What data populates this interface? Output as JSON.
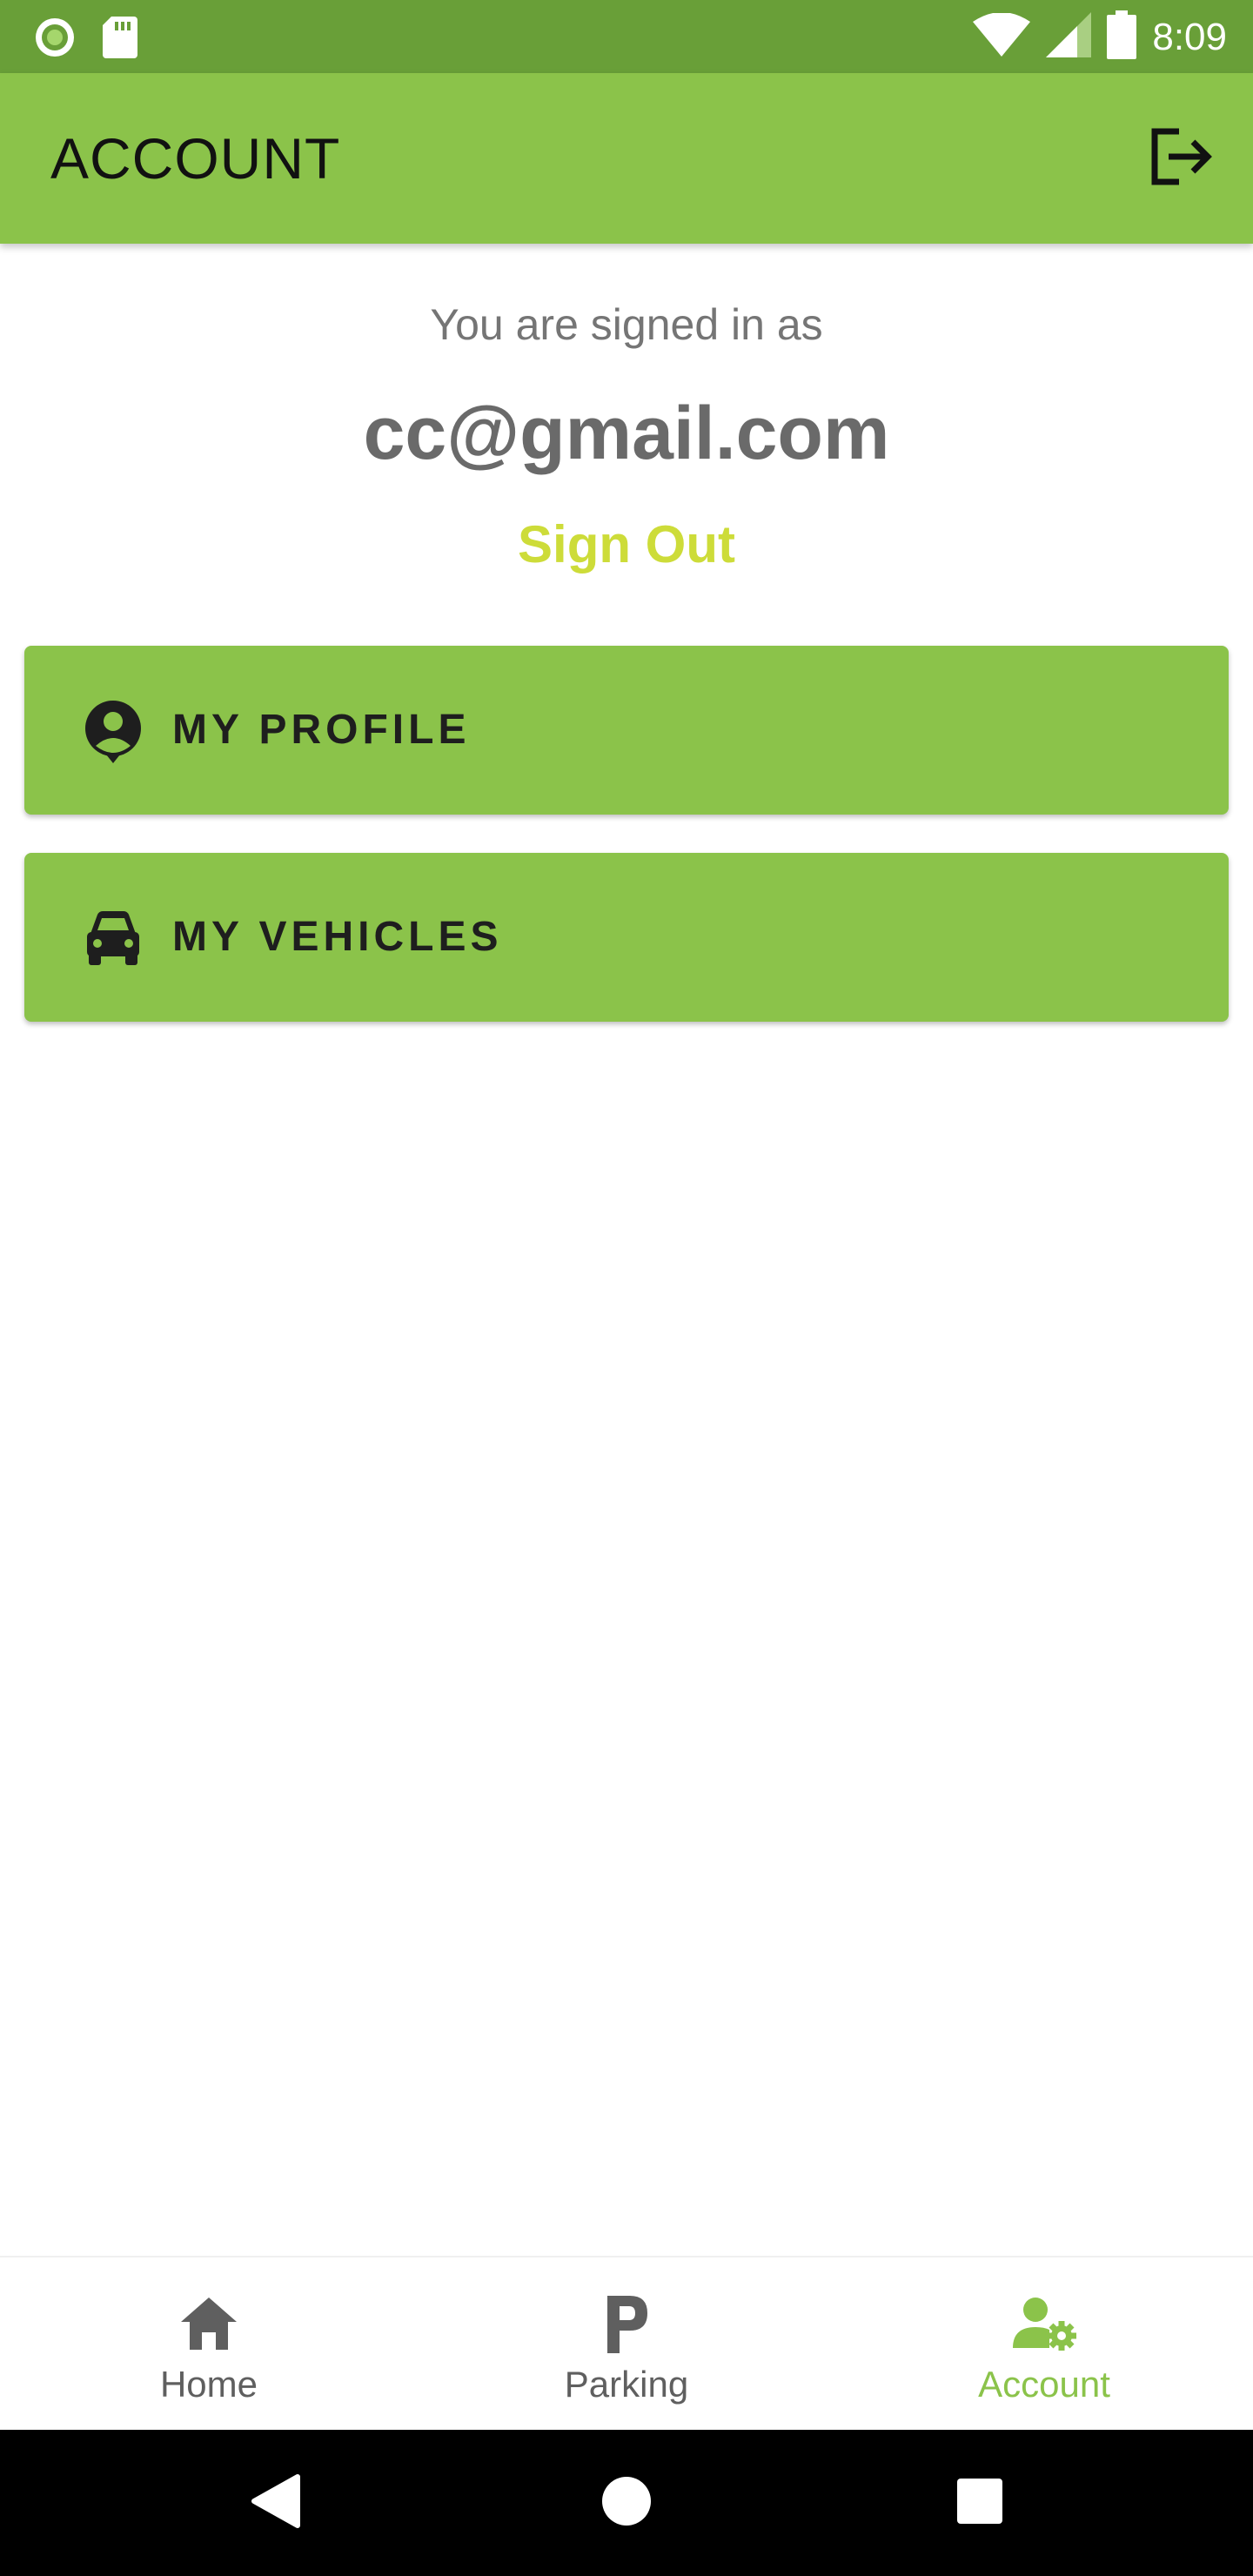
{
  "status_bar": {
    "time": "8:09",
    "icons": [
      "record-icon",
      "sd-card-icon",
      "wifi-icon",
      "cell-signal-icon",
      "battery-icon"
    ]
  },
  "app_bar": {
    "title": "ACCOUNT",
    "action_icon": "logout-icon"
  },
  "account": {
    "signed_in_label": "You are signed in as",
    "email": "cc@gmail.com",
    "sign_out_label": "Sign Out"
  },
  "menu": [
    {
      "label": "MY PROFILE",
      "icon": "account-circle-icon"
    },
    {
      "label": "MY VEHICLES",
      "icon": "car-icon"
    }
  ],
  "bottom_nav": {
    "items": [
      {
        "label": "Home",
        "icon": "home-icon",
        "active": false
      },
      {
        "label": "Parking",
        "icon": "parking-icon",
        "active": false
      },
      {
        "label": "Account",
        "icon": "account-settings-icon",
        "active": true
      }
    ]
  },
  "system_nav": {
    "icons": [
      "back-icon",
      "home-circle-icon",
      "recents-icon"
    ]
  },
  "colors": {
    "primary": "#8bc34a",
    "primary_dark": "#699f38",
    "accent": "#cddc39",
    "text_secondary": "#757575"
  }
}
